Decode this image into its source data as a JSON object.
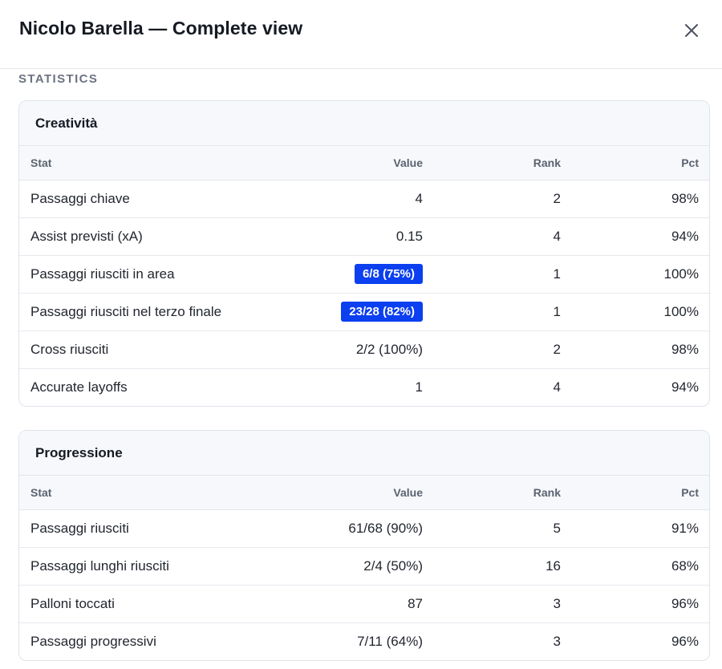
{
  "header": {
    "title": "Nicolo Barella — Complete view",
    "close_icon": "close-icon"
  },
  "section_label": "STATISTICS",
  "columns": {
    "stat": "Stat",
    "value": "Value",
    "rank": "Rank",
    "pct": "Pct"
  },
  "colors": {
    "highlight": "#0b3ff0"
  },
  "cards": [
    {
      "title": "Creatività",
      "rows": [
        {
          "stat": "Passaggi chiave",
          "value": "4",
          "rank": "2",
          "pct": "98%",
          "highlight": false
        },
        {
          "stat": "Assist previsti (xA)",
          "value": "0.15",
          "rank": "4",
          "pct": "94%",
          "highlight": false
        },
        {
          "stat": "Passaggi riusciti in area",
          "value": "6/8 (75%)",
          "rank": "1",
          "pct": "100%",
          "highlight": true
        },
        {
          "stat": "Passaggi riusciti nel terzo finale",
          "value": "23/28 (82%)",
          "rank": "1",
          "pct": "100%",
          "highlight": true
        },
        {
          "stat": "Cross riusciti",
          "value": "2/2 (100%)",
          "rank": "2",
          "pct": "98%",
          "highlight": false
        },
        {
          "stat": "Accurate layoffs",
          "value": "1",
          "rank": "4",
          "pct": "94%",
          "highlight": false
        }
      ]
    },
    {
      "title": "Progressione",
      "rows": [
        {
          "stat": "Passaggi riusciti",
          "value": "61/68 (90%)",
          "rank": "5",
          "pct": "91%",
          "highlight": false
        },
        {
          "stat": "Passaggi lunghi riusciti",
          "value": "2/4 (50%)",
          "rank": "16",
          "pct": "68%",
          "highlight": false
        },
        {
          "stat": "Palloni toccati",
          "value": "87",
          "rank": "3",
          "pct": "96%",
          "highlight": false
        },
        {
          "stat": "Passaggi progressivi",
          "value": "7/11 (64%)",
          "rank": "3",
          "pct": "96%",
          "highlight": false
        }
      ]
    }
  ]
}
